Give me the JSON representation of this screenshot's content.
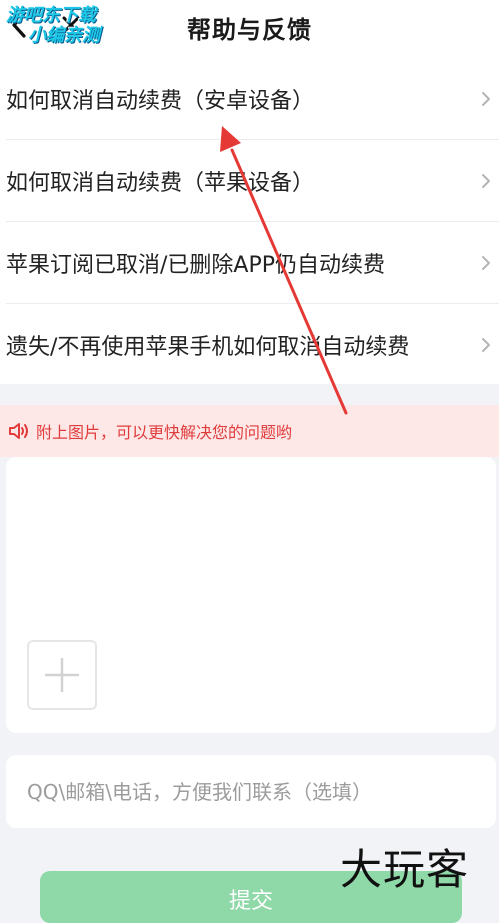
{
  "header": {
    "title": "帮助与反馈",
    "back_icon": "chevron-left-icon",
    "close_icon": "close-icon"
  },
  "watermark": {
    "line1": "游吧东下载",
    "line2": "小编亲测",
    "corner_text": "大玩客"
  },
  "faq": {
    "items": [
      {
        "label": "如何取消自动续费（安卓设备）"
      },
      {
        "label": "如何取消自动续费（苹果设备）"
      },
      {
        "label": "苹果订阅已取消/已删除APP仍自动续费"
      },
      {
        "label": "遗失/不再使用苹果手机如何取消自动续费"
      }
    ],
    "chevron_icon": "chevron-right-icon"
  },
  "notice": {
    "icon": "speaker-icon",
    "text": "附上图片，可以更快解决您的问题哟"
  },
  "feedback": {
    "add_image_icon": "plus-icon"
  },
  "contact": {
    "placeholder": "QQ\\邮箱\\电话，方便我们联系（选填）",
    "value": ""
  },
  "submit": {
    "label": "提交"
  },
  "colors": {
    "accent_red": "#e03c3c",
    "notice_bg": "#fde7e7",
    "submit_green": "#8fd9a8",
    "annotation_arrow": "#e53935"
  }
}
